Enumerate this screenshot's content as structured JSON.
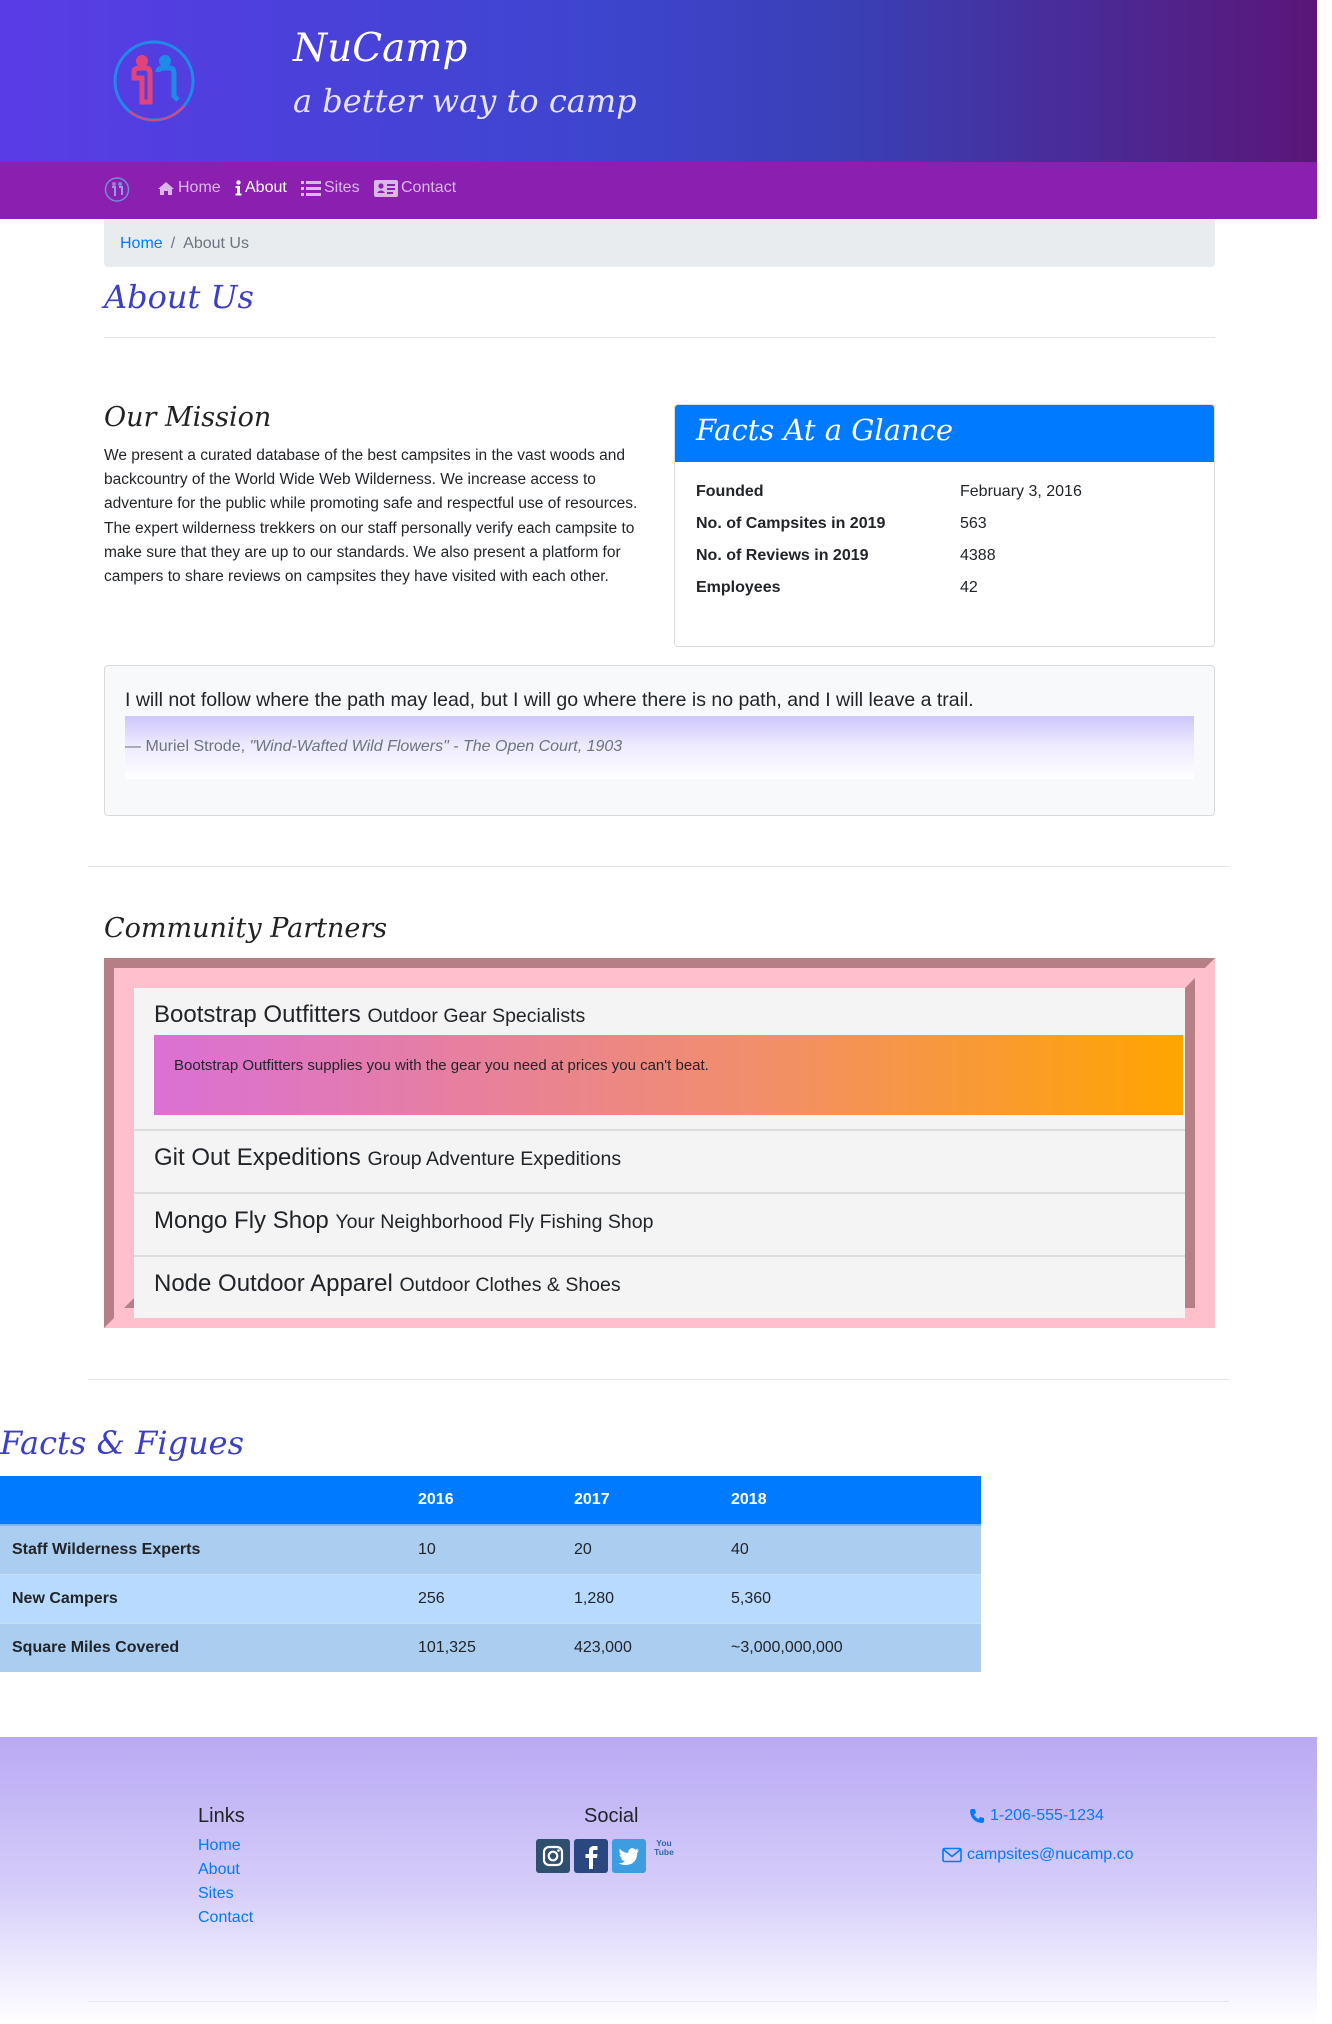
{
  "header": {
    "title": "NuCamp",
    "tagline": "a better way to camp"
  },
  "nav": {
    "items": [
      {
        "label": "Home",
        "icon": "home-icon"
      },
      {
        "label": "About",
        "icon": "info-icon",
        "active": true
      },
      {
        "label": "Sites",
        "icon": "list-icon"
      },
      {
        "label": "Contact",
        "icon": "address-card-icon"
      }
    ]
  },
  "breadcrumb": {
    "home": "Home",
    "separator": "/",
    "current": "About Us"
  },
  "page": {
    "title": "About Us"
  },
  "mission": {
    "title": "Our Mission",
    "text": "We present a curated database of the best campsites in the vast woods and backcountry of the World Wide Web Wilderness. We increase access to adventure for the public while promoting safe and respectful use of resources. The expert wilderness trekkers on our staff personally verify each campsite to make sure that they are up to our standards. We also present a platform for campers to share reviews on campsites they have visited with each other."
  },
  "facts": {
    "title": "Facts At a Glance",
    "rows": [
      {
        "key": "Founded",
        "value": "February 3, 2016"
      },
      {
        "key": "No. of Campsites in 2019",
        "value": "563"
      },
      {
        "key": "No. of Reviews in 2019",
        "value": "4388"
      },
      {
        "key": "Employees",
        "value": "42"
      }
    ]
  },
  "quote": {
    "text": "I will not follow where the path may lead, but I will go where there is no path, and I will leave a trail.",
    "author": "— Muriel Strode,",
    "source": "\"Wind-Wafted Wild Flowers\" - The Open Court, 1903"
  },
  "partners": {
    "title": "Community Partners",
    "items": [
      {
        "name": "Bootstrap Outfitters",
        "tagline": "Outdoor Gear Specialists",
        "description": "Bootstrap Outfitters supplies you with the gear you need at prices you can't beat."
      },
      {
        "name": "Git Out Expeditions",
        "tagline": "Group Adventure Expeditions"
      },
      {
        "name": "Mongo Fly Shop",
        "tagline": "Your Neighborhood Fly Fishing Shop"
      },
      {
        "name": "Node Outdoor Apparel",
        "tagline": "Outdoor Clothes & Shoes"
      }
    ]
  },
  "figures": {
    "title": "Facts & Figues",
    "columns": [
      "",
      "2016",
      "2017",
      "2018"
    ],
    "rows": [
      {
        "label": "Staff Wilderness Experts",
        "values": [
          "10",
          "20",
          "40"
        ]
      },
      {
        "label": "New Campers",
        "values": [
          "256",
          "1,280",
          "5,360"
        ]
      },
      {
        "label": "Square Miles Covered",
        "values": [
          "101,325",
          "423,000",
          "~3,000,000,000"
        ]
      }
    ]
  },
  "footer": {
    "links_title": "Links",
    "links": [
      "Home",
      "About",
      "Sites",
      "Contact"
    ],
    "social_title": "Social",
    "social": [
      "instagram-icon",
      "facebook-icon",
      "twitter-icon",
      "youtube-icon"
    ],
    "youtube_text": "You Tube",
    "phone": "1-206-555-1234",
    "email": "campsites@nucamp.co"
  },
  "colors": {
    "primary": "#007bff",
    "navbar": "#8a1fb0",
    "heading_script": "#3b3fc4"
  }
}
